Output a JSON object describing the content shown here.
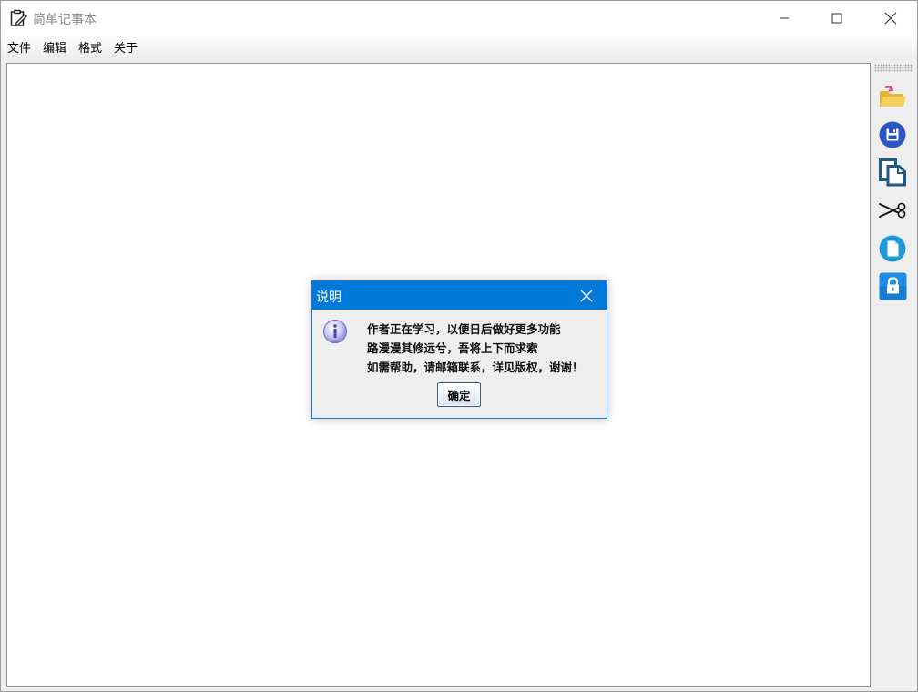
{
  "window": {
    "title": "简单记事本"
  },
  "menubar": {
    "items": [
      "文件",
      "编辑",
      "格式",
      "关于"
    ]
  },
  "toolbar": {
    "icons": [
      "open-folder-icon",
      "save-icon",
      "copy-icon",
      "cut-icon",
      "new-file-icon",
      "lock-icon"
    ]
  },
  "editor": {
    "content": ""
  },
  "dialog": {
    "title": "说明",
    "lines": [
      "作者正在学习，以便日后做好更多功能",
      "路漫漫其修远兮，吾将上下而求索",
      "如需帮助，请邮箱联系，详见版权，谢谢！"
    ],
    "ok_label": "确定",
    "icon": "info-icon"
  },
  "colors": {
    "dialog_titlebar": "#0078d7",
    "save_icon": "#2a56c6",
    "lock_icon": "#1d8ee8",
    "new_file_icon": "#1e9ad6",
    "folder_icon": "#f2c84b"
  }
}
